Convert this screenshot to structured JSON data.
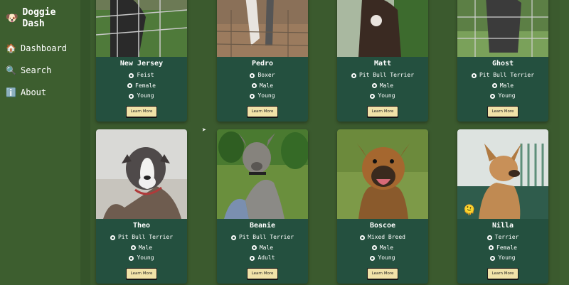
{
  "brand": {
    "name": "Doggie Dash",
    "logo_icon": "dog-face-icon"
  },
  "nav": [
    {
      "label": "Dashboard",
      "icon": "house-icon"
    },
    {
      "label": "Search",
      "icon": "magnifier-icon"
    },
    {
      "label": "About",
      "icon": "info-icon"
    }
  ],
  "cards": [
    {
      "name": "New Jersey",
      "breed": "Feist",
      "sex": "Female",
      "age": "Young",
      "button": "Learn More"
    },
    {
      "name": "Pedro",
      "breed": "Boxer",
      "sex": "Male",
      "age": "Young",
      "button": "Learn More"
    },
    {
      "name": "Matt",
      "breed": "Pit Bull Terrier",
      "sex": "Male",
      "age": "Young",
      "button": "Learn More"
    },
    {
      "name": "Ghost",
      "breed": "Pit Bull Terrier",
      "sex": "Male",
      "age": "Young",
      "button": "Learn More"
    },
    {
      "name": "Theo",
      "breed": "Pit Bull Terrier",
      "sex": "Male",
      "age": "Young",
      "button": "Learn More"
    },
    {
      "name": "Beanie",
      "breed": "Pit Bull Terrier",
      "sex": "Male",
      "age": "Adult",
      "button": "Learn More"
    },
    {
      "name": "Boscoe",
      "breed": "Mixed Breed",
      "sex": "Male",
      "age": "Young",
      "button": "Learn More"
    },
    {
      "name": "Nilla",
      "breed": "Terrier",
      "sex": "Female",
      "age": "Young",
      "button": "Learn More"
    }
  ],
  "colors": {
    "sidebar": "#3d5e2f",
    "card": "#24503f",
    "button": "#f1e2a8"
  }
}
